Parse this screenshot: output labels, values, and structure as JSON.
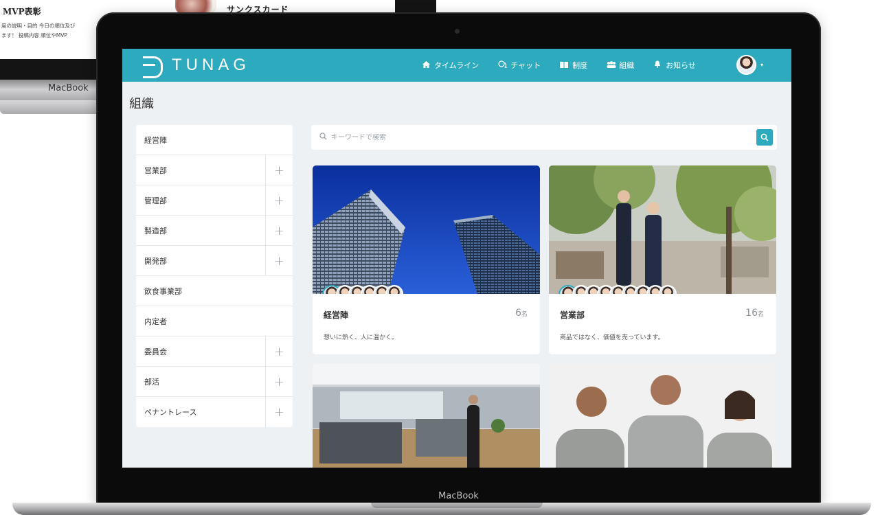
{
  "background_device": {
    "title": "MVP表彰",
    "lines": [
      "度の説明・目的 今日の順位及び",
      "ます！ 投稿内容 順位やMVP"
    ],
    "card_title": "サンクスカード",
    "brand": "MacBook"
  },
  "device": {
    "brand": "MacBook"
  },
  "header": {
    "logo_text": "TUNAG",
    "nav": [
      {
        "label": "タイムライン",
        "icon": "home-icon"
      },
      {
        "label": "チャット",
        "icon": "chat-icon"
      },
      {
        "label": "制度",
        "icon": "book-icon"
      },
      {
        "label": "組織",
        "icon": "people-icon"
      },
      {
        "label": "お知らせ",
        "icon": "bell-icon"
      }
    ],
    "user_menu_caret": "▾"
  },
  "page": {
    "title": "組織"
  },
  "sidebar": {
    "items": [
      {
        "label": "経営陣",
        "expandable": false
      },
      {
        "label": "営業部",
        "expandable": true
      },
      {
        "label": "管理部",
        "expandable": true
      },
      {
        "label": "製造部",
        "expandable": true
      },
      {
        "label": "開発部",
        "expandable": true
      },
      {
        "label": "飲食事業部",
        "expandable": false
      },
      {
        "label": "内定者",
        "expandable": false
      },
      {
        "label": "委員会",
        "expandable": true
      },
      {
        "label": "部活",
        "expandable": true
      },
      {
        "label": "ペナントレース",
        "expandable": true
      }
    ],
    "expand_glyph": "+"
  },
  "search": {
    "placeholder": "キーワードで検索"
  },
  "cards": [
    {
      "name": "経営陣",
      "count": "6",
      "unit": "名",
      "description": "想いに熱く、人に温かく。"
    },
    {
      "name": "営業部",
      "count": "16",
      "unit": "名",
      "description": "商品ではなく、価値を売っています。"
    }
  ],
  "colors": {
    "brand": "#2eaabf",
    "page_bg": "#eef1f4"
  }
}
